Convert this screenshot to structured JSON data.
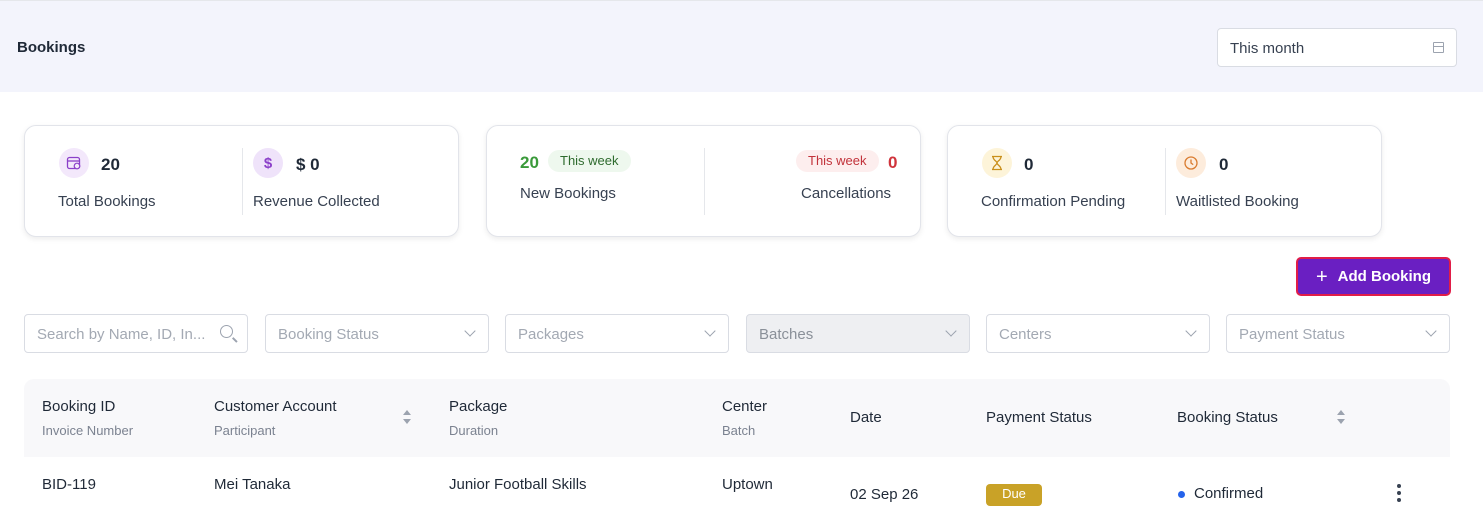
{
  "header": {
    "title": "Bookings",
    "date_range": "This month"
  },
  "stats": {
    "total_bookings": {
      "value": "20",
      "label": "Total Bookings"
    },
    "revenue": {
      "value": "$ 0",
      "label": "Revenue Collected",
      "icon_glyph": "$"
    },
    "new_bookings": {
      "value": "20",
      "period": "This week",
      "label": "New Bookings"
    },
    "cancellations": {
      "value": "0",
      "period": "This week",
      "label": "Cancellations"
    },
    "confirmation_pending": {
      "value": "0",
      "label": "Confirmation Pending"
    },
    "waitlisted": {
      "value": "0",
      "label": "Waitlisted Booking"
    }
  },
  "actions": {
    "add_booking": "Add Booking",
    "add_icon_glyph": "+"
  },
  "filters": {
    "search_placeholder": "Search by Name, ID, In...",
    "booking_status": "Booking Status",
    "packages": "Packages",
    "batches": "Batches",
    "centers": "Centers",
    "payment_status": "Payment Status"
  },
  "table": {
    "columns": {
      "booking_id": "Booking ID",
      "invoice_number": "Invoice Number",
      "customer_account": "Customer Account",
      "participant": "Participant",
      "package": "Package",
      "duration": "Duration",
      "center": "Center",
      "batch": "Batch",
      "date": "Date",
      "payment_status": "Payment Status",
      "booking_status": "Booking Status"
    },
    "rows": [
      {
        "booking_id": "BID-119",
        "customer": "Mei Tanaka",
        "package": "Junior Football Skills",
        "center": "Uptown",
        "date": "02 Sep 26",
        "payment_status": "Due",
        "booking_status": "Confirmed"
      }
    ]
  },
  "colors": {
    "header_bg": "#f3f4fc",
    "accent": "#6a1fc2",
    "button_border": "#e11d48",
    "positive": "#3a9a3a",
    "negative": "#d0343c",
    "due_badge": "#c9a227",
    "confirmed_dot": "#2563eb"
  }
}
